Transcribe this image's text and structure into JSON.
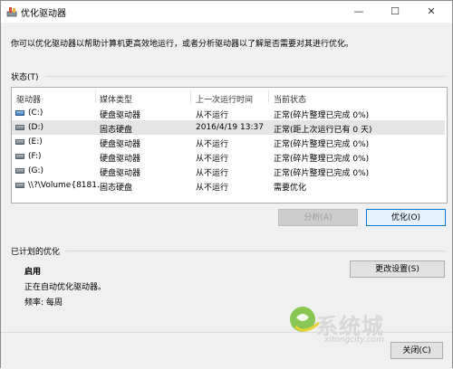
{
  "window": {
    "title": "优化驱动器",
    "min": "—",
    "max": "☐",
    "close": "✕"
  },
  "description": "你可以优化驱动器以帮助计算机更高效地运行，或者分析驱动器以了解是否需要对其进行优化。",
  "status_label": "状态(T)",
  "table": {
    "headers": [
      "驱动器",
      "媒体类型",
      "上一次运行时间",
      "当前状态"
    ],
    "rows": [
      {
        "drive": "(C:)",
        "media": "硬盘驱动器",
        "last_run": "从不运行",
        "status": "正常(碎片整理已完成 0%)",
        "system": true
      },
      {
        "drive": "(D:)",
        "media": "固态硬盘",
        "last_run": "2016/4/19 13:37",
        "status": "正常(距上次运行已有 0 天)",
        "selected": true
      },
      {
        "drive": "(E:)",
        "media": "硬盘驱动器",
        "last_run": "从不运行",
        "status": "正常(碎片整理已完成 0%)"
      },
      {
        "drive": "(F:)",
        "media": "硬盘驱动器",
        "last_run": "从不运行",
        "status": "正常(碎片整理已完成 0%)"
      },
      {
        "drive": "(G:)",
        "media": "硬盘驱动器",
        "last_run": "从不运行",
        "status": "正常(碎片整理已完成 0%)"
      },
      {
        "drive": "\\\\?\\Volume{8181...",
        "media": "固态硬盘",
        "last_run": "从不运行",
        "status": "需要优化"
      }
    ]
  },
  "buttons": {
    "analyze": "分析(A)",
    "optimize": "优化(O)",
    "change_settings": "更改设置(S)",
    "close": "关闭(C)"
  },
  "scheduled": {
    "label": "已计划的优化",
    "enabled": "启用",
    "auto_text": "正在自动优化驱动器。",
    "frequency": "频率: 每周"
  },
  "watermark": {
    "text": "系统城",
    "url": "xitongcity.com"
  }
}
